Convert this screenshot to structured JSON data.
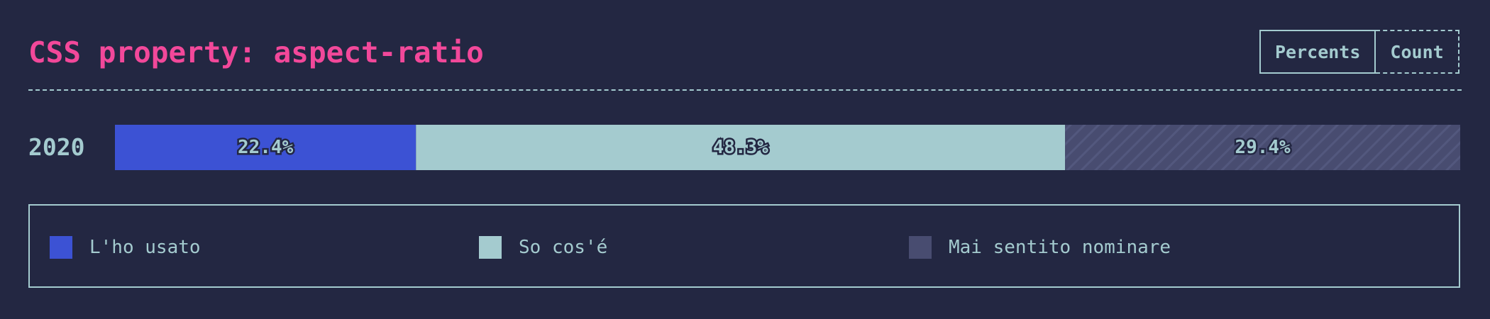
{
  "title": "CSS property: aspect-ratio",
  "toggle": {
    "percents_label": "Percents",
    "count_label": "Count",
    "active": "percents"
  },
  "colors": {
    "background": "#232742",
    "accent": "#f2489a",
    "text": "#a4cbcf",
    "used": "#3c52d4",
    "know": "#a4cbcf",
    "never": "#484c70"
  },
  "chart_data": {
    "type": "bar",
    "orientation": "horizontal",
    "stacked": true,
    "normalized": true,
    "categories": [
      "2020"
    ],
    "series": [
      {
        "name": "L'ho usato",
        "values": [
          22.4
        ],
        "labels": [
          "22.4%"
        ],
        "color": "#3c52d4"
      },
      {
        "name": "So cos'é",
        "values": [
          48.3
        ],
        "labels": [
          "48.3%"
        ],
        "color": "#a4cbcf"
      },
      {
        "name": "Mai sentito nominare",
        "values": [
          29.4
        ],
        "labels": [
          "29.4%"
        ],
        "color": "#484c70",
        "pattern": "diagonal-hatch"
      }
    ],
    "legend_position": "bottom",
    "grid": false
  }
}
